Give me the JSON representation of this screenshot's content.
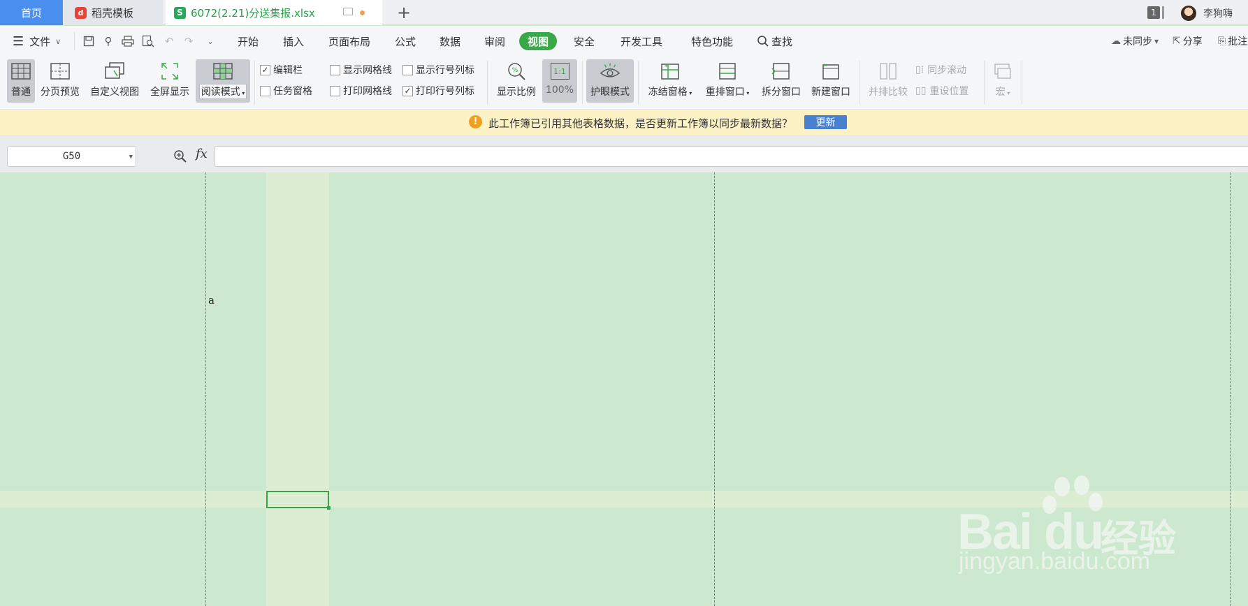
{
  "tabs": {
    "home": "首页",
    "template": "稻壳模板",
    "file": "6072(2.21)分送集报.xlsx",
    "add": "+"
  },
  "window_count": "1",
  "user": {
    "name": "李狗嗨"
  },
  "menu": {
    "file": "文件",
    "items": [
      "开始",
      "插入",
      "页面布局",
      "公式",
      "数据",
      "审阅",
      "视图",
      "安全",
      "开发工具",
      "特色功能"
    ],
    "active": "视图",
    "search": "查找",
    "sync": "未同步",
    "share": "分享",
    "review": "批注"
  },
  "toolbar": {
    "normal": "普通",
    "page_break": "分页预览",
    "custom_view": "自定义视图",
    "fullscreen": "全屏显示",
    "reading_mode": "阅读模式",
    "edit_bar": "编辑栏",
    "task_pane": "任务窗格",
    "show_gridlines": "显示网格线",
    "print_gridlines": "打印网格线",
    "show_headers": "显示行号列标",
    "print_headers": "打印行号列标",
    "zoom": "显示比例",
    "zoom_100": "100%",
    "zoom_icon": "1:1",
    "eye_mode": "护眼模式",
    "freeze": "冻结窗格",
    "arrange": "重排窗口",
    "split": "拆分窗口",
    "new_window": "新建窗口",
    "side_by_side": "并排比较",
    "sync_scroll": "同步滚动",
    "reset_pos": "重设位置",
    "macro": "宏"
  },
  "checks": {
    "edit_bar": true,
    "task_pane": false,
    "show_gridlines": false,
    "print_gridlines": false,
    "show_headers": false,
    "print_headers": true
  },
  "notification": {
    "message": "此工作簿已引用其他表格数据，是否更新工作簿以同步最新数据？",
    "button": "更新"
  },
  "formula_bar": {
    "cell_ref": "G50",
    "fx": "fx",
    "value": ""
  },
  "sheet": {
    "cell_text": "a"
  },
  "watermark": {
    "brand": "Bai du",
    "jingyan": "经验",
    "url": "jingyan.baidu.com"
  },
  "colors": {
    "eye_mode_bg": "#cce8cf",
    "accent": "#38a848",
    "home_tab": "#4a8ff0",
    "notify_bg": "#fdf1c6"
  }
}
